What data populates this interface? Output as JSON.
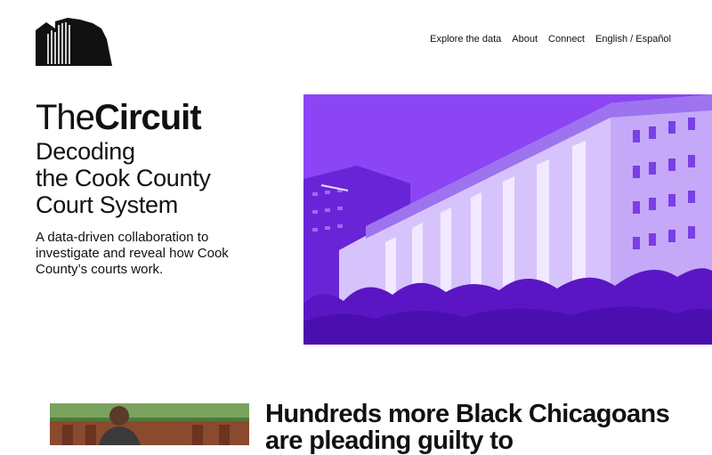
{
  "header": {
    "logo_icon": "building-logo-icon",
    "nav": [
      {
        "label": "Explore the data"
      },
      {
        "label": "About"
      },
      {
        "label": "Connect"
      },
      {
        "label": "English / Español"
      }
    ]
  },
  "intro": {
    "brand_light": "The",
    "brand_bold": "Circuit",
    "tagline": "Decoding\nthe Cook County\nCourt System",
    "description": "A data-driven collaboration to investigate and reveal how Cook County’s courts work."
  },
  "hero_image": {
    "subject": "courthouse-photo-purple-duotone",
    "tint": "#8B45F5"
  },
  "featured_story": {
    "thumbnail": "man-in-front-of-building-photo",
    "title": "Hundreds more Black Chicagoans are pleading guilty to"
  },
  "colors": {
    "accent": "#8B45F5",
    "text": "#111111",
    "background": "#FFFFFF"
  }
}
